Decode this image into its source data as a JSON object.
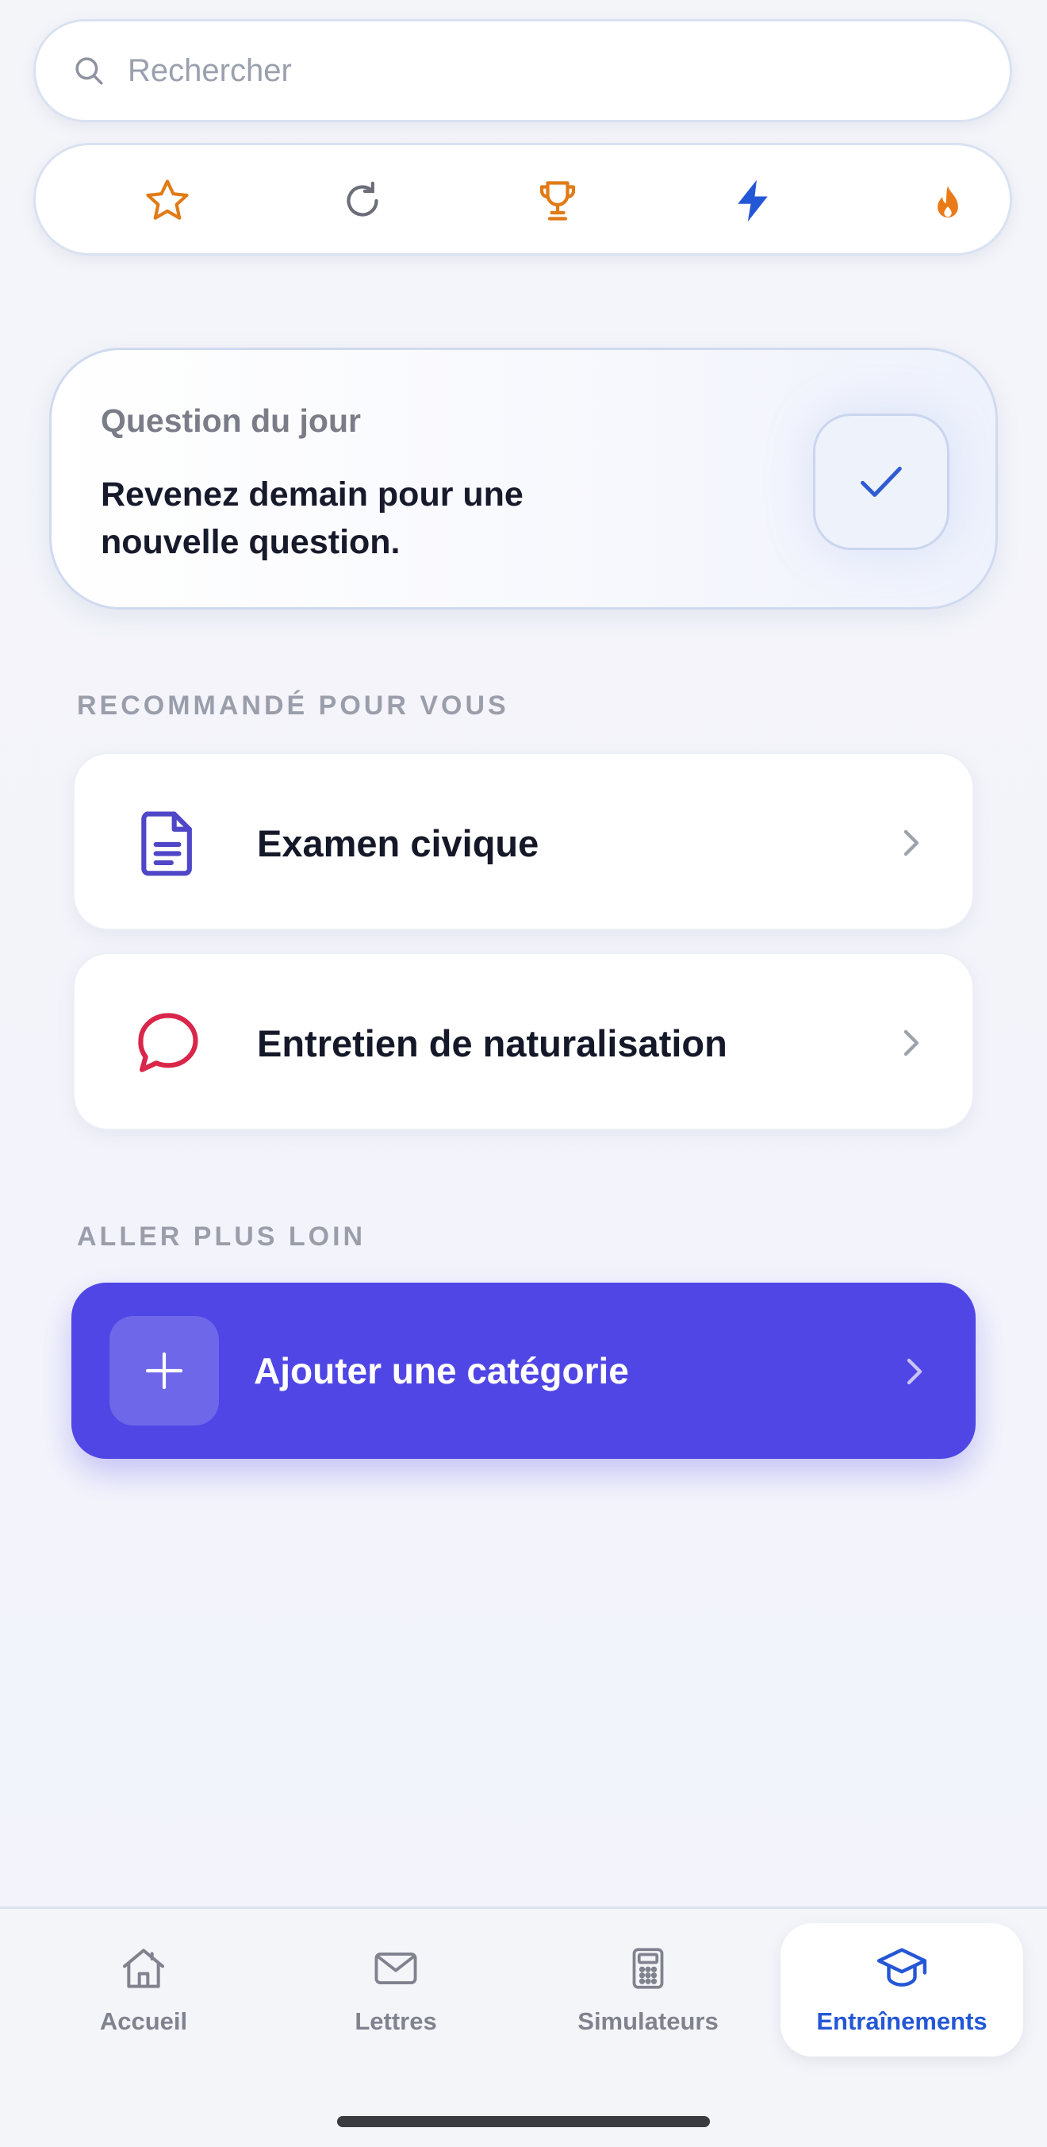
{
  "search": {
    "placeholder": "Rechercher"
  },
  "quick_filters": [
    {
      "icon": "star-icon",
      "color": "#e07b16"
    },
    {
      "icon": "refresh-icon",
      "color": "#6b6e78"
    },
    {
      "icon": "trophy-icon",
      "color": "#e07b16"
    },
    {
      "icon": "lightning-icon",
      "color": "#2457d6"
    },
    {
      "icon": "flame-icon",
      "color": "#ea7a17"
    }
  ],
  "question_du_jour": {
    "title": "Question du jour",
    "message": "Revenez demain pour une nouvelle question.",
    "status_icon": "check-icon"
  },
  "recommended": {
    "label": "RECOMMANDÉ POUR VOUS",
    "items": [
      {
        "label": "Examen civique",
        "icon": "document-icon",
        "color": "#4f46c8"
      },
      {
        "label": "Entretien de naturalisation",
        "icon": "chat-bubble-icon",
        "color": "#d9264a"
      }
    ]
  },
  "further": {
    "label": "ALLER PLUS LOIN",
    "add_label": "Ajouter une catégorie",
    "color": "#4f46e5"
  },
  "tabbar": {
    "items": [
      {
        "label": "Accueil",
        "icon": "home-icon"
      },
      {
        "label": "Lettres",
        "icon": "mail-icon"
      },
      {
        "label": "Simulateurs",
        "icon": "calculator-icon"
      },
      {
        "label": "Entraînements",
        "icon": "graduation-cap-icon",
        "active": true
      }
    ],
    "active_color": "#2457d6"
  }
}
